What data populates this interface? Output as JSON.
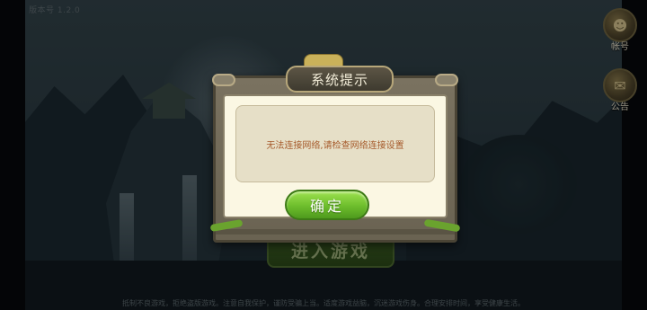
{
  "status": {
    "version_text": "版本号 1.2.0"
  },
  "side_buttons": {
    "account": {
      "label": "帐号",
      "icon": "account-icon"
    },
    "notice": {
      "label": "公告",
      "icon": "notice-icon"
    }
  },
  "main": {
    "enter_label": "进入游戏"
  },
  "dialog": {
    "title": "系统提示",
    "message": "无法连接网络,请检查网络连接设置",
    "ok_label": "确定"
  },
  "footer": {
    "text": "抵制不良游戏，拒绝盗版游戏。注意自我保护，谨防受骗上当。适度游戏益脑，沉迷游戏伤身。合理安排时间，享受健康生活。"
  },
  "colors": {
    "ok_button": "#6dbd2c",
    "message_text": "#a65b2c",
    "dialog_frame": "#6a6352"
  }
}
